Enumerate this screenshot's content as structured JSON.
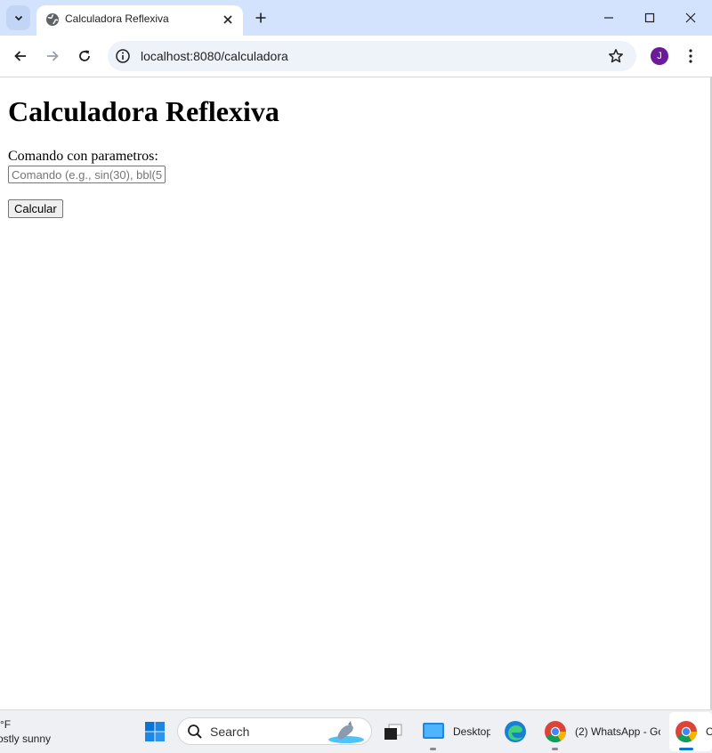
{
  "browser": {
    "tab_title": "Calculadora Reflexiva",
    "url": "localhost:8080/calculadora",
    "profile_initial": "J"
  },
  "page": {
    "heading": "Calculadora Reflexiva",
    "field_label": "Comando con parametros:",
    "input_value": "",
    "input_placeholder": "Comando (e.g., sin(30), bbl(5",
    "submit_label": "Calcular"
  },
  "taskbar": {
    "weather_temp": "°F",
    "weather_desc": "ostly sunny",
    "search_label": "Search",
    "apps": [
      {
        "label": "Desktop"
      },
      {
        "label": ""
      },
      {
        "label": "(2) WhatsApp - Goo"
      },
      {
        "label": "Ca"
      }
    ]
  },
  "colors": {
    "titlebar": "#d3e3fd",
    "omnibox": "#eef2f9",
    "avatar": "#6a1b9a"
  }
}
